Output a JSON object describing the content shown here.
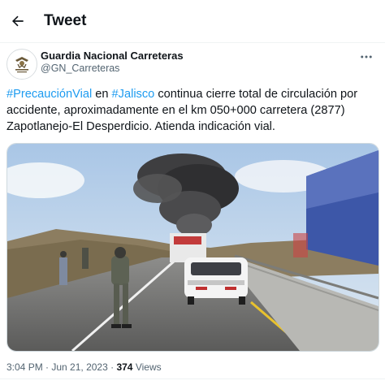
{
  "header": {
    "title": "Tweet",
    "back_icon": "arrow-left-icon"
  },
  "author": {
    "avatar_text": "GUARDIA NACIONAL",
    "name": "Guardia Nacional Carreteras",
    "handle": "@GN_Carreteras",
    "more_icon": "more-horizontal-icon"
  },
  "tweet": {
    "hashtag1": "#PrecauciónVial",
    "text_en": " en ",
    "hashtag2": "#Jalisco",
    "text_rest": " continua cierre total de circulación por accidente, aproximadamente en el km 050+000 carretera (2877) Zapotlanejo-El Desperdicio. Atienda indicación vial."
  },
  "meta": {
    "time": "3:04 PM",
    "sep1": " · ",
    "date": "Jun 21, 2023",
    "sep2": " · ",
    "views_count": "374",
    "views_label": " Views"
  },
  "colors": {
    "link": "#1d9bf0",
    "text": "#0f1419",
    "secondary": "#536471",
    "divider": "#eff3f4"
  }
}
